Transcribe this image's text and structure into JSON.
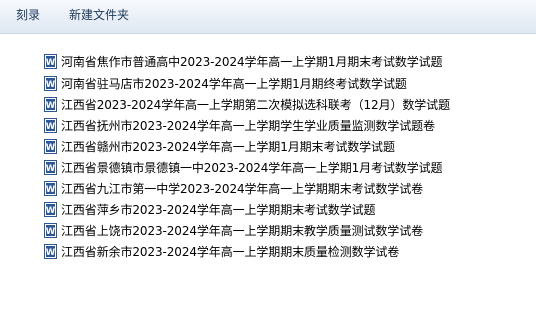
{
  "toolbar": {
    "burn_label": "刻录",
    "new_folder_label": "新建文件夹"
  },
  "files": [
    {
      "name": "河南省焦作市普通高中2023-2024学年高一上学期1月期末考试数学试题",
      "icon": "word-doc-icon"
    },
    {
      "name": "河南省驻马店市2023-2024学年高一上学期1月期终考试数学试题",
      "icon": "word-doc-icon"
    },
    {
      "name": "江西省2023-2024学年高一上学期第二次模拟选科联考（12月）数学试题",
      "icon": "word-doc-icon"
    },
    {
      "name": "江西省抚州市2023-2024学年高一上学期学生学业质量监测数学试题卷",
      "icon": "word-doc-icon"
    },
    {
      "name": "江西省赣州市2023-2024学年高一上学期1月期末考试数学试题",
      "icon": "word-doc-icon"
    },
    {
      "name": "江西省景德镇市景德镇一中2023-2024学年高一上学期1月考试数学试题",
      "icon": "word-doc-icon"
    },
    {
      "name": "江西省九江市第一中学2023-2024学年高一上学期期末考试数学试卷",
      "icon": "word-doc-icon"
    },
    {
      "name": "江西省萍乡市2023-2024学年高一上学期期末考试数学试题",
      "icon": "word-doc-icon"
    },
    {
      "name": "江西省上饶市2023-2024学年高一上学期期末教学质量测试数学试卷",
      "icon": "word-doc-icon"
    },
    {
      "name": "江西省新余市2023-2024学年高一上学期期末质量检测数学试卷",
      "icon": "word-doc-icon"
    }
  ],
  "colors": {
    "toolbar_text": "#1e395b",
    "icon_blue": "#2b5797"
  }
}
